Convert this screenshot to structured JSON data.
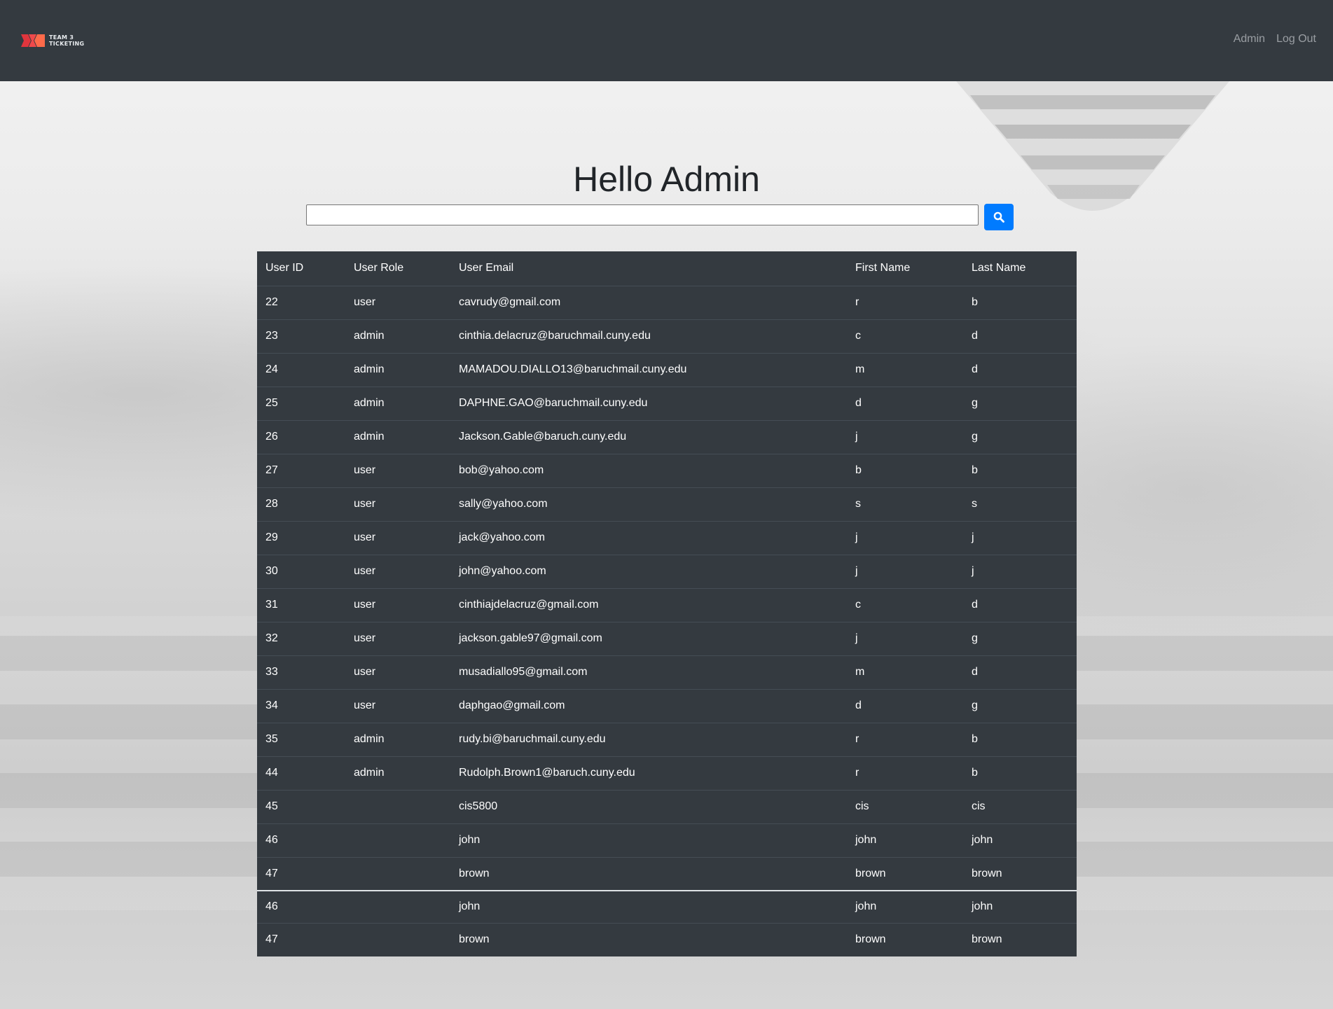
{
  "navbar": {
    "logo": {
      "line1": "TEAM 3",
      "line2": "TICKETING",
      "colors": [
        "#e0353d",
        "#f0494b",
        "#ff6a4a"
      ]
    },
    "links": [
      {
        "label": "Admin"
      },
      {
        "label": "Log Out"
      }
    ]
  },
  "main": {
    "title": "Hello Admin",
    "search": {
      "value": "",
      "placeholder": "",
      "button_icon": "search-icon",
      "button_color": "#007bff"
    }
  },
  "table": {
    "columns": [
      "User ID",
      "User Role",
      "User Email",
      "First Name",
      "Last Name"
    ],
    "rows": [
      {
        "id": "22",
        "role": "user",
        "email": "cavrudy@gmail.com",
        "first": "r",
        "last": "b"
      },
      {
        "id": "23",
        "role": "admin",
        "email": "cinthia.delacruz@baruchmail.cuny.edu",
        "first": "c",
        "last": "d"
      },
      {
        "id": "24",
        "role": "admin",
        "email": "MAMADOU.DIALLO13@baruchmail.cuny.edu",
        "first": "m",
        "last": "d"
      },
      {
        "id": "25",
        "role": "admin",
        "email": "DAPHNE.GAO@baruchmail.cuny.edu",
        "first": "d",
        "last": "g"
      },
      {
        "id": "26",
        "role": "admin",
        "email": "Jackson.Gable@baruch.cuny.edu",
        "first": "j",
        "last": "g"
      },
      {
        "id": "27",
        "role": "user",
        "email": "bob@yahoo.com",
        "first": "b",
        "last": "b"
      },
      {
        "id": "28",
        "role": "user",
        "email": "sally@yahoo.com",
        "first": "s",
        "last": "s"
      },
      {
        "id": "29",
        "role": "user",
        "email": "jack@yahoo.com",
        "first": "j",
        "last": "j"
      },
      {
        "id": "30",
        "role": "user",
        "email": "john@yahoo.com",
        "first": "j",
        "last": "j"
      },
      {
        "id": "31",
        "role": "user",
        "email": "cinthiajdelacruz@gmail.com",
        "first": "c",
        "last": "d"
      },
      {
        "id": "32",
        "role": "user",
        "email": "jackson.gable97@gmail.com",
        "first": "j",
        "last": "g"
      },
      {
        "id": "33",
        "role": "user",
        "email": "musadiallo95@gmail.com",
        "first": "m",
        "last": "d"
      },
      {
        "id": "34",
        "role": "user",
        "email": "daphgao@gmail.com",
        "first": "d",
        "last": "g"
      },
      {
        "id": "35",
        "role": "admin",
        "email": "rudy.bi@baruchmail.cuny.edu",
        "first": "r",
        "last": "b"
      },
      {
        "id": "44",
        "role": "admin",
        "email": "Rudolph.Brown1@baruch.cuny.edu",
        "first": "r",
        "last": "b"
      },
      {
        "id": "45",
        "role": "",
        "email": "cis5800",
        "first": "cis",
        "last": "cis"
      },
      {
        "id": "46",
        "role": "",
        "email": "john",
        "first": "john",
        "last": "john"
      },
      {
        "id": "47",
        "role": "",
        "email": "brown",
        "first": "brown",
        "last": "brown"
      }
    ],
    "extra_rows": [
      {
        "id": "46",
        "role": "",
        "email": "john",
        "first": "john",
        "last": "john"
      },
      {
        "id": "47",
        "role": "",
        "email": "brown",
        "first": "brown",
        "last": "brown"
      }
    ]
  },
  "colors": {
    "navbar_bg": "#343a40",
    "table_bg": "#343a40",
    "nav_link": "#9a9ea3",
    "primary": "#007bff"
  }
}
